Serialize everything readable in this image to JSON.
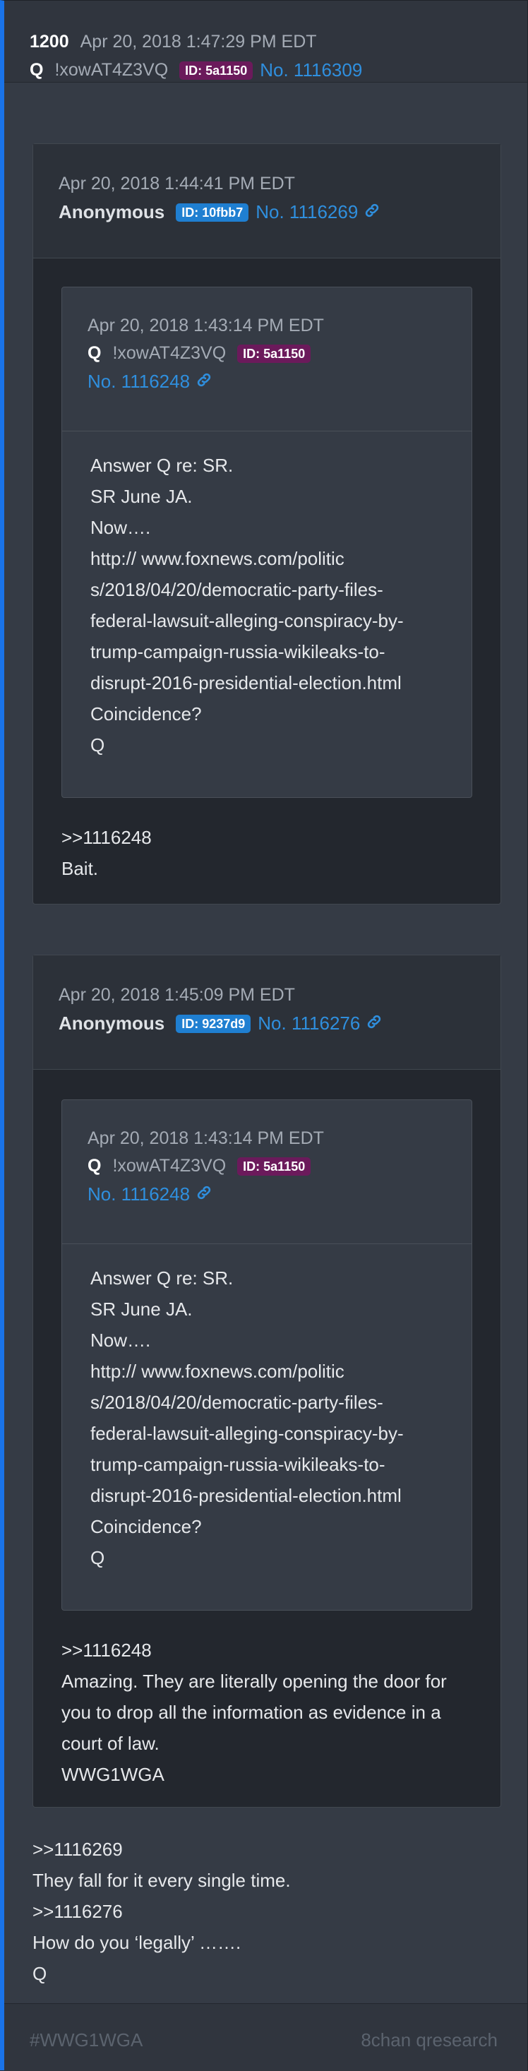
{
  "post": {
    "number": "1200",
    "date": "Apr 20, 2018 1:47:29 PM EDT",
    "name": "Q",
    "tripcode": "!xowAT4Z3VQ",
    "id_badge": "ID: 5a1150",
    "post_link": "No. 1116309"
  },
  "quoted_posts": [
    {
      "date": "Apr 20, 2018 1:44:41 PM EDT",
      "name": "Anonymous",
      "id_badge": "ID: 10fbb7",
      "post_link": "No. 1116269",
      "inner": {
        "date": "Apr 20, 2018 1:43:14 PM EDT",
        "name": "Q",
        "tripcode": "!xowAT4Z3VQ",
        "id_badge": "ID: 5a1150",
        "post_link": "No. 1116248",
        "lines": [
          "Answer Q re: SR.",
          "SR June JA.",
          "Now….",
          "http:// www.foxnews.com/politic",
          "s/2018/04/20/democratic-party-files-",
          "federal-lawsuit-alleging-conspiracy-by-",
          "trump-campaign-russia-wikileaks-to-",
          "disrupt-2016-presidential-election.html",
          "Coincidence?",
          "Q"
        ]
      },
      "lines": [
        ">>1116248",
        "Bait."
      ]
    },
    {
      "date": "Apr 20, 2018 1:45:09 PM EDT",
      "name": "Anonymous",
      "id_badge": "ID: 9237d9",
      "post_link": "No. 1116276",
      "inner": {
        "date": "Apr 20, 2018 1:43:14 PM EDT",
        "name": "Q",
        "tripcode": "!xowAT4Z3VQ",
        "id_badge": "ID: 5a1150",
        "post_link": "No. 1116248",
        "lines": [
          "Answer Q re: SR.",
          "SR June JA.",
          "Now….",
          "http:// www.foxnews.com/politic",
          "s/2018/04/20/democratic-party-files-",
          "federal-lawsuit-alleging-conspiracy-by-",
          "trump-campaign-russia-wikileaks-to-",
          "disrupt-2016-presidential-election.html",
          "Coincidence?",
          "Q"
        ]
      },
      "lines": [
        ">>1116248",
        "Amazing. They are literally opening the door for",
        "you to drop all the information as evidence in a",
        "court of law.",
        "WWG1WGA"
      ]
    }
  ],
  "body_lines": [
    ">>1116269",
    "They fall for it every single time.",
    ">>1116276",
    "How do you ‘legally’ …….",
    "Q"
  ],
  "footer": {
    "hashtag": "#WWG1WGA",
    "site": "8chan qresearch"
  },
  "colors": {
    "accent_bar": "#1a73e8",
    "q_id_badge": "#6b1a5b",
    "anon_id_badge": "#1f7fd1",
    "link": "#2f8fde"
  },
  "icons": [
    "link-chain-icon"
  ]
}
